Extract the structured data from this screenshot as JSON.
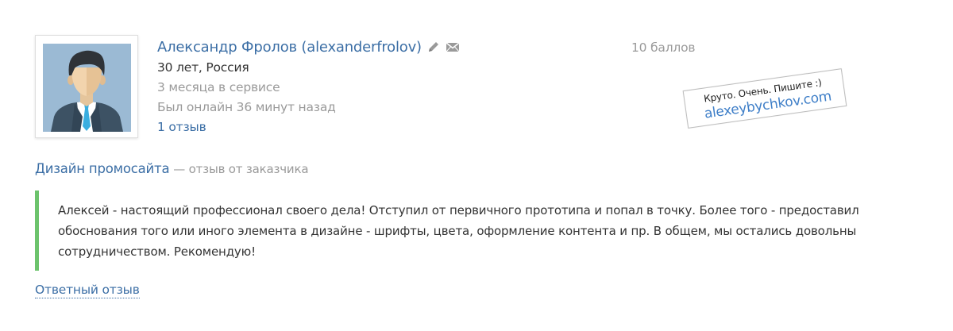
{
  "profile": {
    "name": "Александр Фролов (alexanderfrolov)",
    "age_country": "30 лет, Россия",
    "service_time": "3 месяца в сервисе",
    "last_online": "Был онлайн 36 минут назад",
    "reviews_count": "1 отзыв",
    "edit_icon": "pencil-icon",
    "message_icon": "envelope-icon"
  },
  "score": "10 баллов",
  "stamp": {
    "line1": "Круто. Очень. Пишите :)",
    "line2": "alexeybychkov.com"
  },
  "review": {
    "project": "Дизайн промосайта",
    "type": "— отзыв от заказчика",
    "text": "Алексей - настоящий профессионал своего дела! Отступил от первичного прототипа и попал в точку. Более того - предоставил обоснования того или иного элемента в дизайне - шрифты, цвета, оформление контента и пр. В общем, мы остались довольны сотрудничеством. Рекомендую!",
    "accent_color": "#6cc36c"
  },
  "reply_link": "Ответный отзыв"
}
